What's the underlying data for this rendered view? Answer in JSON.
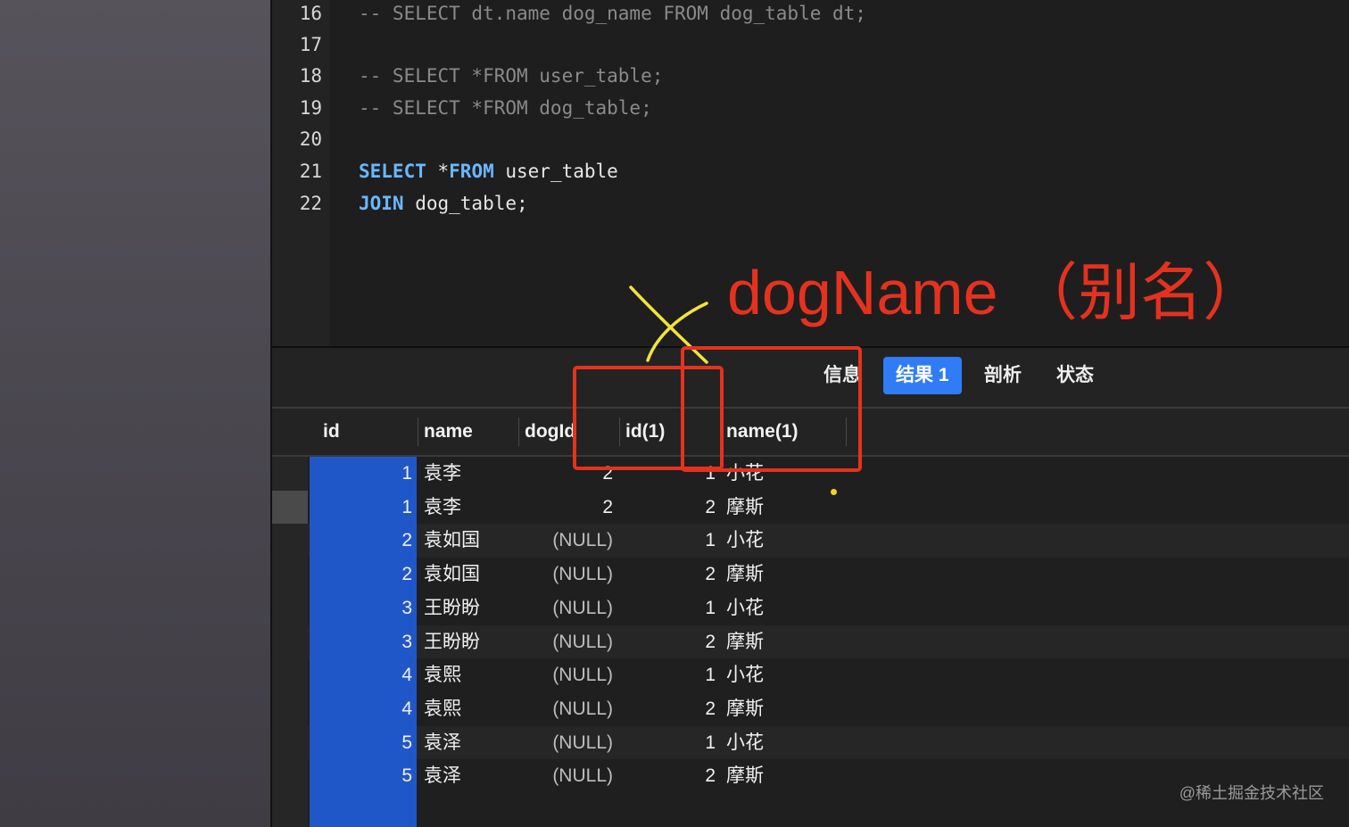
{
  "editor": {
    "lines": [
      {
        "num": "16",
        "segments": [
          {
            "text": "-- SELECT dt.name dog_name FROM dog_table dt;",
            "type": "comment"
          }
        ]
      },
      {
        "num": "17",
        "segments": []
      },
      {
        "num": "18",
        "segments": [
          {
            "text": "-- SELECT *FROM user_table;",
            "type": "comment"
          }
        ]
      },
      {
        "num": "19",
        "segments": [
          {
            "text": "-- SELECT *FROM dog_table;",
            "type": "comment"
          }
        ]
      },
      {
        "num": "20",
        "segments": []
      },
      {
        "num": "21",
        "segments": [
          {
            "text": "SELECT",
            "type": "kw"
          },
          {
            "text": " *",
            "type": "plain"
          },
          {
            "text": "FROM",
            "type": "kw"
          },
          {
            "text": " user_table",
            "type": "plain"
          }
        ]
      },
      {
        "num": "22",
        "segments": [
          {
            "text": "JOIN",
            "type": "kw"
          },
          {
            "text": " dog_table;",
            "type": "plain"
          }
        ]
      }
    ]
  },
  "tabs": {
    "info": "信息",
    "result1": "结果 1",
    "profile": "剖析",
    "status": "状态"
  },
  "table": {
    "columns": [
      "id",
      "name",
      "dogId",
      "id(1)",
      "name(1)"
    ],
    "rows": [
      [
        "1",
        "袁李",
        "2",
        "1",
        "小花"
      ],
      [
        "1",
        "袁李",
        "2",
        "2",
        "摩斯"
      ],
      [
        "2",
        "袁如国",
        "(NULL)",
        "1",
        "小花"
      ],
      [
        "2",
        "袁如国",
        "(NULL)",
        "2",
        "摩斯"
      ],
      [
        "3",
        "王盼盼",
        "(NULL)",
        "1",
        "小花"
      ],
      [
        "3",
        "王盼盼",
        "(NULL)",
        "2",
        "摩斯"
      ],
      [
        "4",
        "袁熙",
        "(NULL)",
        "1",
        "小花"
      ],
      [
        "4",
        "袁熙",
        "(NULL)",
        "2",
        "摩斯"
      ],
      [
        "5",
        "袁泽",
        "(NULL)",
        "1",
        "小花"
      ],
      [
        "5",
        "袁泽",
        "(NULL)",
        "2",
        "摩斯"
      ]
    ]
  },
  "annotation": {
    "label": "dogName （别名）",
    "color": "#e4321f",
    "x_mark_color": "#f3e33a"
  },
  "watermark": "@稀土掘金技术社区"
}
